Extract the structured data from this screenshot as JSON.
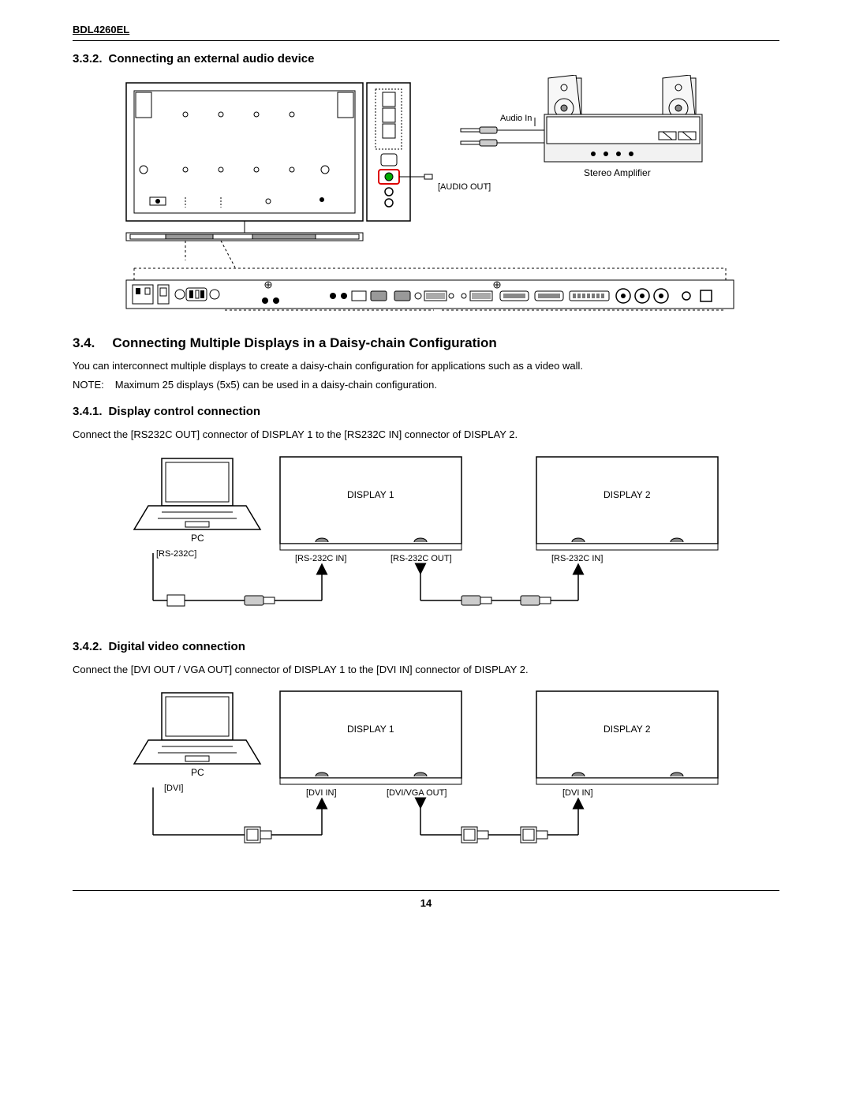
{
  "header": {
    "model": "BDL4260EL"
  },
  "sections": {
    "s332": {
      "num": "3.3.2.",
      "title": "Connecting an external audio device"
    },
    "s34": {
      "num": "3.4.",
      "title": "Connecting Multiple Displays in a Daisy-chain Configuration",
      "text": "You can interconnect multiple displays to create a daisy-chain configuration for applications such as a video wall.",
      "note_label": "NOTE:",
      "note_text": "Maximum 25 displays (5x5) can be used in a daisy-chain configuration."
    },
    "s341": {
      "num": "3.4.1.",
      "title": "Display control connection",
      "text": "Connect the [RS232C OUT] connector of DISPLAY 1 to the [RS232C IN] connector of DISPLAY 2."
    },
    "s342": {
      "num": "3.4.2.",
      "title": "Digital video connection",
      "text": "Connect the [DVI OUT / VGA OUT] connector of DISPLAY 1 to the [DVI IN] connector of DISPLAY 2."
    }
  },
  "diagrams": {
    "audio": {
      "audio_in": "Audio In",
      "audio_out": "[AUDIO OUT]",
      "amp": "Stereo Amplifier"
    },
    "rs232": {
      "pc": "PC",
      "pc_port": "[RS-232C]",
      "d1": "DISPLAY 1",
      "d1_in": "[RS-232C IN]",
      "d1_out": "[RS-232C OUT]",
      "d2": "DISPLAY 2",
      "d2_in": "[RS-232C IN]"
    },
    "dvi": {
      "pc": "PC",
      "pc_port": "[DVI]",
      "d1": "DISPLAY 1",
      "d1_in": "[DVI IN]",
      "d1_out": "[DVI/VGA OUT]",
      "d2": "DISPLAY 2",
      "d2_in": "[DVI IN]"
    }
  },
  "page": "14"
}
